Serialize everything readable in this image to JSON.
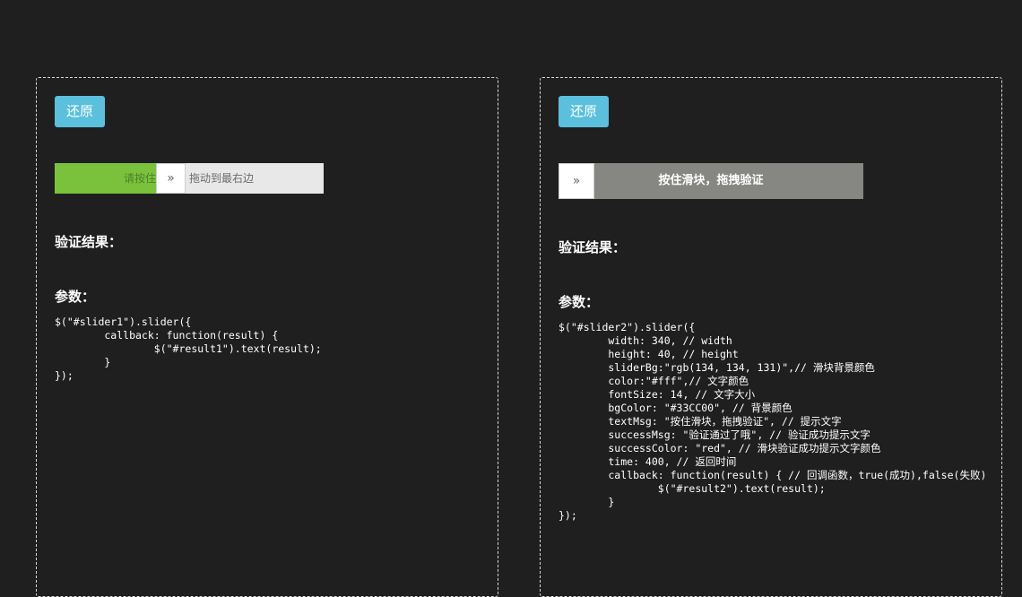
{
  "panel1": {
    "reset_label": "还原",
    "slider": {
      "passed_text": "请按住",
      "handle_icon": "»",
      "remaining_text": "拖动到最右边",
      "progress_fraction": 0.38,
      "fill_color": "#7ac23c"
    },
    "result_label": "验证结果：",
    "result_value": "",
    "params_label": "参数：",
    "code": "$(\"#slider1\").slider({\n        callback: function(result) {\n                $(\"#result1\").text(result);\n        }\n});"
  },
  "panel2": {
    "reset_label": "还原",
    "slider": {
      "handle_icon": "»",
      "text": "按住滑块，拖拽验证",
      "bg_color": "#868683"
    },
    "result_label": "验证结果：",
    "result_value": "",
    "params_label": "参数：",
    "code": "$(\"#slider2\").slider({\n        width: 340, // width\n        height: 40, // height\n        sliderBg:\"rgb(134, 134, 131)\",// 滑块背景颜色\n        color:\"#fff\",// 文字颜色\n        fontSize: 14, // 文字大小\n        bgColor: \"#33CC00\", // 背景颜色\n        textMsg: \"按住滑块，拖拽验证\", // 提示文字\n        successMsg: \"验证通过了哦\", // 验证成功提示文字\n        successColor: \"red\", // 滑块验证成功提示文字颜色\n        time: 400, // 返回时间\n        callback: function(result) { // 回调函数，true(成功),false(失败)\n                $(\"#result2\").text(result);\n        }\n});"
  }
}
